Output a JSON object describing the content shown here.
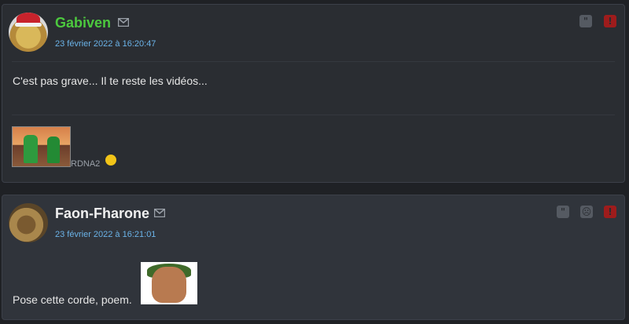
{
  "posts": [
    {
      "author": "Gabiven",
      "date": "23 février 2022 à 16:20:47",
      "message": "C'est pas grave... Il te reste les vidéos...",
      "signature_text": "RDNA2",
      "actions": {
        "quote": "\"",
        "report": "!"
      },
      "colors": {
        "author": "#4cc93e",
        "date": "#6bb3e8"
      }
    },
    {
      "author": "Faon-Fharone",
      "date": "23 février 2022 à 16:21:01",
      "message": "Pose cette corde, poem.",
      "actions": {
        "quote": "\"",
        "neutral": "☹",
        "report": "!"
      },
      "colors": {
        "author": "#f0f0f0",
        "date": "#6bb3e8"
      }
    }
  ],
  "icons": [
    "avatar-gabiven",
    "mail-icon",
    "quote-icon",
    "report-icon",
    "neutral-face-icon",
    "avatar-faon-fharone",
    "emoji-icon"
  ]
}
